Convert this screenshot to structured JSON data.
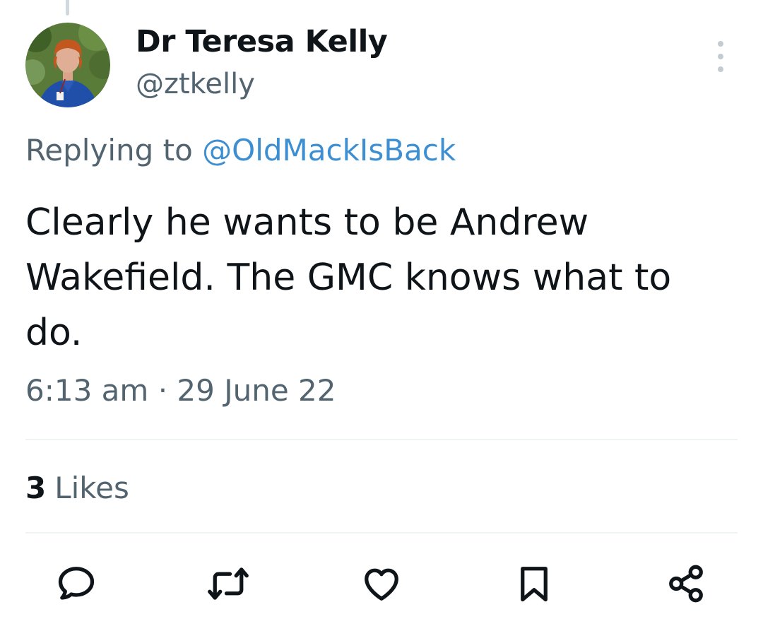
{
  "tweet": {
    "author": {
      "display_name": "Dr Teresa Kelly",
      "handle": "@ztkelly",
      "avatar_icon": "profile-photo"
    },
    "reply_prefix": "Replying to",
    "reply_to_handle": "@OldMackIsBack",
    "text": "Clearly he wants to be Andrew Wakefield. The GMC knows what to do.",
    "time": "6:13 am",
    "separator": "·",
    "date": "29 June 22",
    "likes_count": "3",
    "likes_label": "Likes"
  },
  "actions": [
    {
      "name": "reply",
      "icon": "reply-icon"
    },
    {
      "name": "retweet",
      "icon": "retweet-icon"
    },
    {
      "name": "like",
      "icon": "heart-icon"
    },
    {
      "name": "bookmark",
      "icon": "bookmark-icon"
    },
    {
      "name": "share",
      "icon": "share-icon"
    }
  ],
  "colors": {
    "text_primary": "#0f1419",
    "text_secondary": "#536471",
    "mention": "#3d8fd1",
    "divider": "#eff3f4"
  }
}
